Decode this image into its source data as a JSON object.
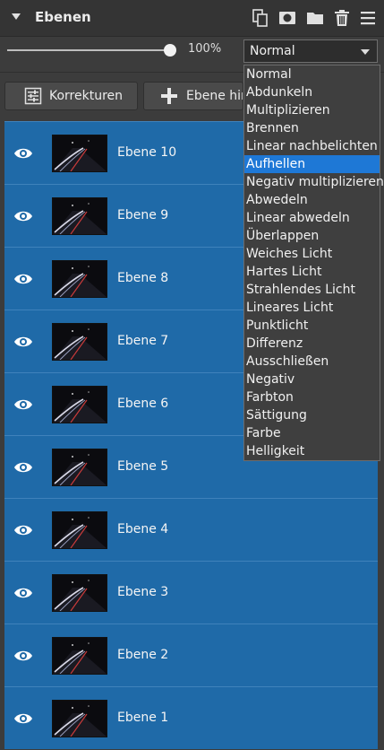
{
  "panel": {
    "title": "Ebenen",
    "header_icons": [
      "duplicate-layer-icon",
      "add-mask-icon",
      "folder-icon",
      "trash-icon",
      "menu-icon"
    ]
  },
  "opacity": {
    "label": "100%",
    "value": 1.0
  },
  "blend_mode": {
    "selected": "Normal",
    "highlighted": "Aufhellen",
    "options": [
      "Normal",
      "Abdunkeln",
      "Multiplizieren",
      "Brennen",
      "Linear nachbelichten",
      "Aufhellen",
      "Negativ multiplizieren",
      "Abwedeln",
      "Linear abwedeln",
      "Überlappen",
      "Weiches Licht",
      "Hartes Licht",
      "Strahlendes Licht",
      "Lineares Licht",
      "Punktlicht",
      "Differenz",
      "Ausschließen",
      "Negativ",
      "Farbton",
      "Sättigung",
      "Farbe",
      "Helligkeit"
    ]
  },
  "buttons": {
    "adjustments": "Korrekturen",
    "add_layer": "Ebene hinzufügen"
  },
  "layers": [
    {
      "name": "Ebene 10"
    },
    {
      "name": "Ebene 9"
    },
    {
      "name": "Ebene 8"
    },
    {
      "name": "Ebene 7"
    },
    {
      "name": "Ebene 6"
    },
    {
      "name": "Ebene 5"
    },
    {
      "name": "Ebene 4"
    },
    {
      "name": "Ebene 3"
    },
    {
      "name": "Ebene 2"
    },
    {
      "name": "Ebene 1"
    }
  ],
  "colors": {
    "layer_selected": "#1f6aa8",
    "dropdown_highlight": "#1e78d6",
    "panel_bg": "#3c3c3c"
  }
}
